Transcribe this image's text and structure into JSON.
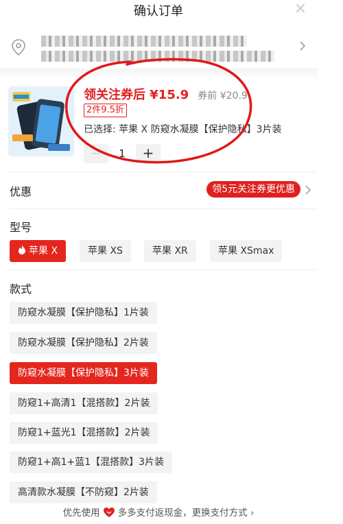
{
  "header": {
    "title": "确认订单",
    "close_glyph": "×"
  },
  "address": {
    "icon": "location-pin-icon",
    "arrow_icon": "chevron-right-icon"
  },
  "product": {
    "price_label": "领关注券后 ¥15.9",
    "original_price": "券前 ¥20.9",
    "promo_tag": "2件9.5折",
    "selected_text": "已选择: 苹果 X 防窥水凝膜【保护隐私】3片装",
    "quantity": "1",
    "minus_glyph": "−",
    "plus_glyph": "+"
  },
  "discount": {
    "label": "优惠",
    "coupon": "领5元关注券更优惠"
  },
  "model": {
    "label": "型号",
    "options": [
      "苹果 X",
      "苹果 XS",
      "苹果 XR",
      "苹果 XSmax"
    ],
    "selected_index": 0
  },
  "style": {
    "label": "款式",
    "options": [
      "防窥水凝膜【保护隐私】1片装",
      "防窥水凝膜【保护隐私】2片装",
      "防窥水凝膜【保护隐私】3片装",
      "防窥1+高清1【混搭款】2片装",
      "防窥1+蓝光1【混搭款】2片装",
      "防窥1+高1+蓝1【混搭款】3片装",
      "高清款水凝膜【不防窥】2片装"
    ],
    "selected_index": 2
  },
  "footer": {
    "text_before": "优先使用",
    "text_after": "多多支付返现金，更换支付方式",
    "arrow": "›"
  },
  "colors": {
    "accent": "#e02020",
    "chip_bg": "#f3f3f3"
  }
}
